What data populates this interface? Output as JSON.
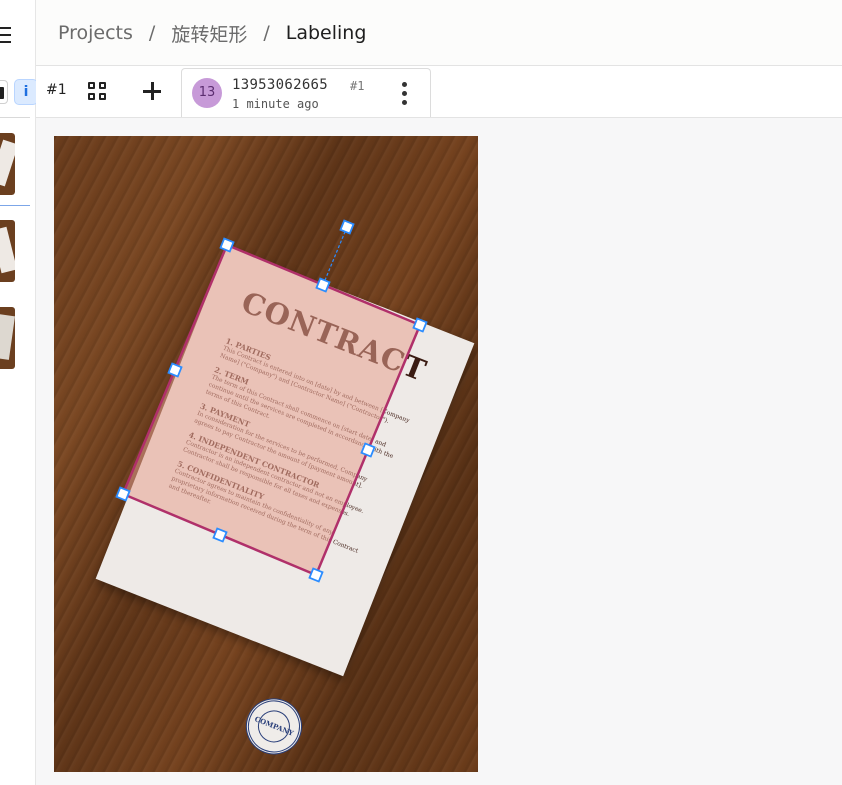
{
  "breadcrumb": {
    "projects": "Projects",
    "project": "旋转矩形",
    "current": "Labeling"
  },
  "left_strip": {
    "tool_info_label": "i",
    "thumbnails": 3
  },
  "toolbar": {
    "task_number": "#1",
    "grid_icon": "grid-view-icon",
    "add_icon": "plus-icon"
  },
  "annotation": {
    "avatar_initials": "13",
    "user": "13953062665",
    "id": "#1",
    "time": "1 minute ago",
    "avatar_color": "#c79ad8"
  },
  "document": {
    "title": "CONTRACT",
    "sections": [
      {
        "heading": "1. PARTIES",
        "text": "This Contract is entered into on [date] by and between [Company Name] (\"Company\") and [Contractor Name] (\"Contractor\")."
      },
      {
        "heading": "2. TERM",
        "text": "The term of this Contract shall commence on [start date] and continue until the services are completed in accordance with the terms of this Contract."
      },
      {
        "heading": "3. PAYMENT",
        "text": "In consideration for the services to be performed, Company agrees to pay Contractor the amount of [payment amount]."
      },
      {
        "heading": "4. INDEPENDENT CONTRACTOR",
        "text": "Contractor is an independent contractor and not an employee. Contractor shall be responsible for all taxes and expenses."
      },
      {
        "heading": "5. CONFIDENTIALITY",
        "text": "Contractor agrees to maintain the confidentiality of any proprietary information received during the term of this Contract and thereafter."
      }
    ],
    "stamp_text": "COMPANY"
  },
  "colors": {
    "bbox_stroke": "#b0306a",
    "bbox_fill": "#e8a090",
    "handle_stroke": "#2b8cff",
    "accent": "#1e6fe0"
  }
}
